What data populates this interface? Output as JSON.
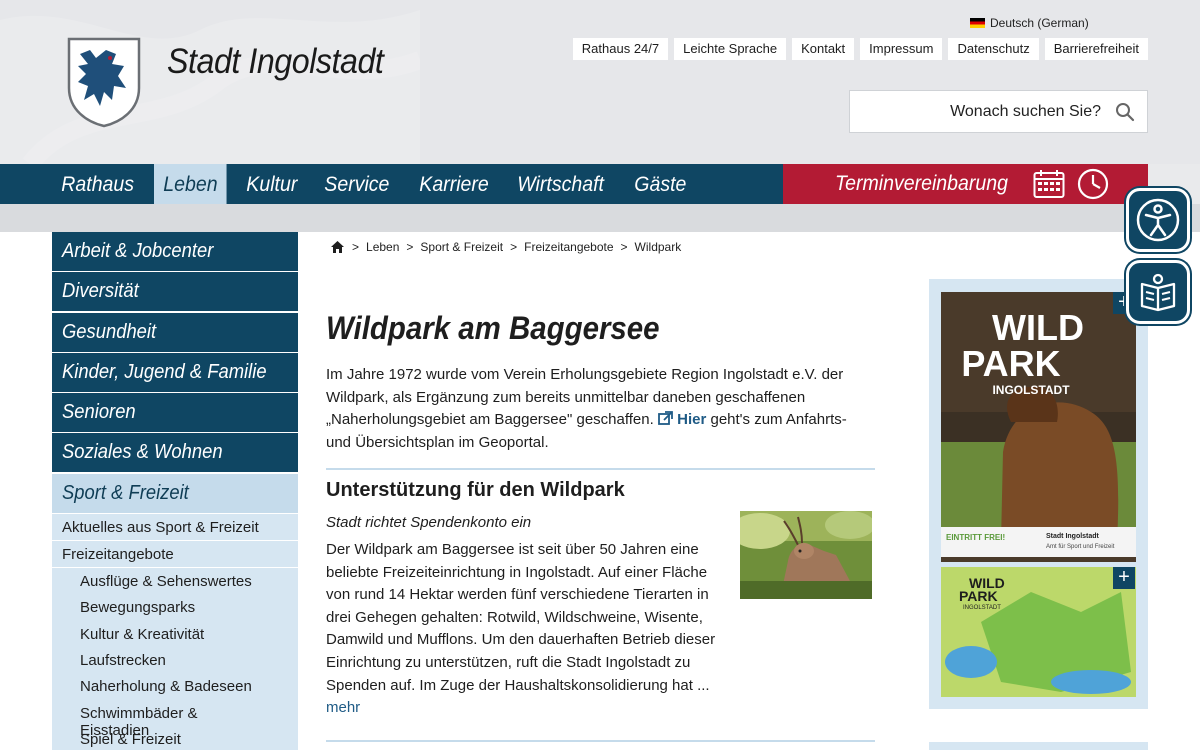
{
  "header": {
    "site_title": "Stadt Ingolstadt",
    "language": "Deutsch (German)",
    "topnav": [
      "Rathaus 24/7",
      "Leichte Sprache",
      "Kontakt",
      "Impressum",
      "Datenschutz",
      "Barrierefreiheit"
    ],
    "search_placeholder": "Wonach suchen Sie?"
  },
  "mainnav": {
    "items": [
      "Rathaus",
      "Leben",
      "Kultur",
      "Service",
      "Karriere",
      "Wirtschaft",
      "Gäste"
    ],
    "active": "Leben",
    "termin_label": "Terminvereinbarung"
  },
  "sidebar": {
    "main_items": [
      "Arbeit & Jobcenter",
      "Diversität",
      "Gesundheit",
      "Kinder, Jugend & Familie",
      "Senioren",
      "Soziales & Wohnen",
      "Sport & Freizeit"
    ],
    "active": "Sport & Freizeit",
    "sub_items": [
      "Aktuelles aus Sport & Freizeit",
      "Freizeitangebote"
    ],
    "subsub_items": [
      "Ausflüge & Sehenswertes",
      "Bewegungsparks",
      "Kultur & Kreativität",
      "Laufstrecken",
      "Naherholung & Badeseen",
      "Schwimmbäder & Eisstadien",
      "Spiel & Freizeit"
    ]
  },
  "breadcrumb": [
    "Leben",
    "Sport & Freizeit",
    "Freizeitangebote",
    "Wildpark"
  ],
  "article": {
    "title": "Wildpark am Baggersee",
    "intro_part1": "Im Jahre 1972 wurde vom Verein Erholungsgebiete Region Ingolstadt e.V. der Wildpark, als Ergänzung zum bereits unmittelbar daneben geschaffenen „Naherholungsgebiet am Baggersee\" geschaffen.",
    "intro_link": "Hier",
    "intro_part2": "geht's zum Anfahrts- und Übersichtsplan im Geoportal.",
    "section_title": "Unterstützung für den Wildpark",
    "section_subtitle": "Stadt richtet Spendenkonto ein",
    "section_body": "Der Wildpark am Baggersee ist seit über 50 Jahren eine beliebte Freizeiteinrichtung in Ingolstadt. Auf einer Fläche von rund 14 Hektar werden fünf verschiedene Tierarten in drei Gehegen gehalten: Rotwild, Wildschweine, Wisente, Damwild und Mufflons. Um den dauerhaften Betrieb dieser Einrichtung zu unterstützen, ruft die Stadt Ingolstadt zu Spenden auf. Im Zuge der Haushaltskonsolidierung hat ...",
    "more_label": "mehr"
  },
  "poster": {
    "line1": "WILD",
    "line2": "PARK",
    "line3": "INGOLSTADT",
    "badge": "EINTRITT FREI!",
    "org_line1": "Stadt Ingolstadt",
    "org_line2": "Amt für Sport und Freizeit",
    "map_line1": "WILD",
    "map_line2": "PARK",
    "map_line3": "INGOLSTADT"
  },
  "colors": {
    "nav_blue": "#0f4663",
    "active_blue": "#c5dbeb",
    "termin_red": "#b31b34",
    "link": "#1f5b86"
  }
}
